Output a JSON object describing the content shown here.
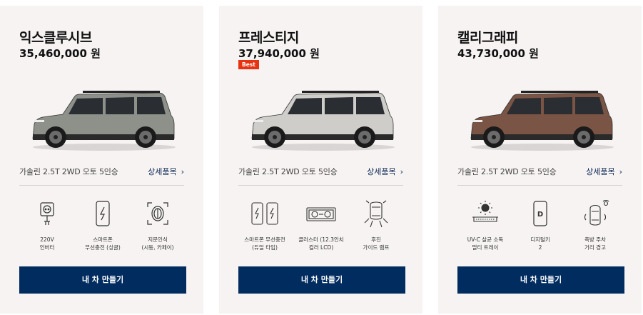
{
  "cards": [
    {
      "name": "익스클루시브",
      "price": "35,460,000 원",
      "badge": "",
      "car_color": "#8d918a",
      "trim": "가솔린 2.5T 2WD 오토 5인승",
      "detail_link": "상세품목",
      "features": [
        {
          "icon": "outlet-icon",
          "label": "220V\n인버터"
        },
        {
          "icon": "phone-charging-icon",
          "label": "스마트폰\n무선충전 (싱글)"
        },
        {
          "icon": "fingerprint-icon",
          "label": "지문인식\n(시동, 카페이)"
        }
      ],
      "button": "내 차 만들기"
    },
    {
      "name": "프레스티지",
      "price": "37,940,000 원",
      "badge": "Best",
      "car_color": "#cfcdca",
      "trim": "가솔린 2.5T 2WD 오토 5인승",
      "detail_link": "상세품목",
      "features": [
        {
          "icon": "dual-phone-charging-icon",
          "label": "스마트폰 무선충전\n(듀얼 타입)"
        },
        {
          "icon": "cluster-display-icon",
          "label": "클러스터 (12.3인치\n컬러 LCD)"
        },
        {
          "icon": "rear-guide-lamp-icon",
          "label": "후진\n가이드 램프"
        }
      ],
      "button": "내 차 만들기"
    },
    {
      "name": "캘리그래피",
      "price": "43,730,000 원",
      "badge": "",
      "car_color": "#7a5444",
      "trim": "가솔린 2.5T 2WD 오토 5인승",
      "detail_link": "상세품목",
      "features": [
        {
          "icon": "uv-tray-icon",
          "label": "UV-C 살균 소독\n멀티 트레이"
        },
        {
          "icon": "digital-key-icon",
          "label": "디지털키\n2"
        },
        {
          "icon": "side-parking-warning-icon",
          "label": "측방 주차\n거리 경고"
        }
      ],
      "button": "내 차 만들기"
    }
  ]
}
